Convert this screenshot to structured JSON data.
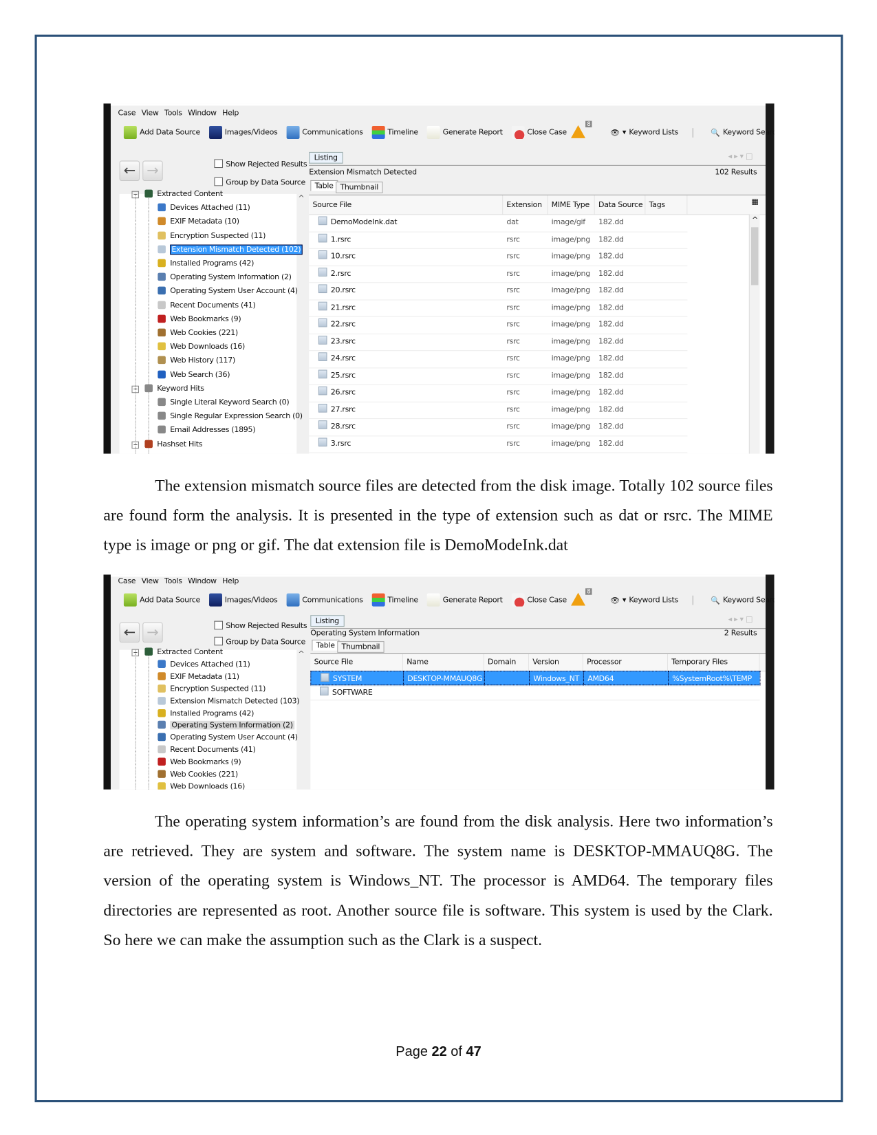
{
  "document": {
    "paragraph_1": "The extension mismatch source files are detected from the disk image. Totally 102 source files are found form the analysis. It is presented in the type of extension such as dat or rsrc. The MIME type is image or png or gif. The dat extension file is DemoModeInk.dat",
    "paragraph_2": "The operating system information’s are found from the disk analysis. Here two information’s are retrieved. They are system and software. The system name is DESKTOP-MMAUQ8G. The version of the operating system is Windows_NT. The processor is AMD64. The temporary files directories are represented as root. Another source file is software. This system is used by the Clark. So here we can make the assumption such as the Clark is a suspect.",
    "footer": {
      "prefix": "Page ",
      "current": "22",
      "middle": " of ",
      "total": "47"
    }
  },
  "app": {
    "menu": [
      "Case",
      "View",
      "Tools",
      "Window",
      "Help"
    ],
    "toolbar": {
      "add_data_source": "Add Data Source",
      "images_videos": "Images/Videos",
      "communications": "Communications",
      "timeline": "Timeline",
      "generate_report": "Generate Report",
      "close_case": "Close Case",
      "warning_count": "8",
      "keyword_lists": "Keyword Lists",
      "keyword_search": "Keyword Search"
    },
    "show_rejected": "Show Rejected Results",
    "group_by_source": "Group by Data Source",
    "listing_tab": "Listing",
    "table_tab": "Table",
    "thumbnail_tab": "Thumbnail",
    "selection_color": "#3399ff"
  },
  "screenshot_1": {
    "title": "Extension Mismatch Detected",
    "results": "102  Results",
    "tree": [
      {
        "label": "Extracted Content",
        "level": 0,
        "icon": "extracted-content-icon"
      },
      {
        "label": "Devices Attached (11)",
        "level": 1,
        "icon": "usb-device-icon"
      },
      {
        "label": "EXIF Metadata (10)",
        "level": 1,
        "icon": "camera-icon"
      },
      {
        "label": "Encryption Suspected (11)",
        "level": 1,
        "icon": "lock-file-icon"
      },
      {
        "label": "Extension Mismatch Detected (102)",
        "level": 1,
        "icon": "file-icon",
        "selected": true
      },
      {
        "label": "Installed Programs (42)",
        "level": 1,
        "icon": "programs-icon"
      },
      {
        "label": "Operating System Information (2)",
        "level": 1,
        "icon": "computer-icon"
      },
      {
        "label": "Operating System User Account (4)",
        "level": 1,
        "icon": "user-icon"
      },
      {
        "label": "Recent Documents (41)",
        "level": 1,
        "icon": "document-icon"
      },
      {
        "label": "Web Bookmarks (9)",
        "level": 1,
        "icon": "bookmark-icon"
      },
      {
        "label": "Web Cookies (221)",
        "level": 1,
        "icon": "cookie-icon"
      },
      {
        "label": "Web Downloads (16)",
        "level": 1,
        "icon": "download-icon"
      },
      {
        "label": "Web History (117)",
        "level": 1,
        "icon": "hourglass-icon"
      },
      {
        "label": "Web Search (36)",
        "level": 1,
        "icon": "globe-icon"
      },
      {
        "label": "Keyword Hits",
        "level": 0,
        "icon": "search-icon"
      },
      {
        "label": "Single Literal Keyword Search (0)",
        "level": 1,
        "icon": "search-icon"
      },
      {
        "label": "Single Regular Expression Search (0)",
        "level": 1,
        "icon": "search-icon"
      },
      {
        "label": "Email Addresses (1895)",
        "level": 1,
        "icon": "search-icon"
      },
      {
        "label": "Hashset Hits",
        "level": 0,
        "icon": "hashset-icon"
      }
    ],
    "columns": [
      "Source File",
      "Extension",
      "MIME Type",
      "Data Source",
      "Tags"
    ],
    "rows": [
      [
        "DemoModeInk.dat",
        "dat",
        "image/gif",
        "182.dd",
        ""
      ],
      [
        "1.rsrc",
        "rsrc",
        "image/png",
        "182.dd",
        ""
      ],
      [
        "10.rsrc",
        "rsrc",
        "image/png",
        "182.dd",
        ""
      ],
      [
        "2.rsrc",
        "rsrc",
        "image/png",
        "182.dd",
        ""
      ],
      [
        "20.rsrc",
        "rsrc",
        "image/png",
        "182.dd",
        ""
      ],
      [
        "21.rsrc",
        "rsrc",
        "image/png",
        "182.dd",
        ""
      ],
      [
        "22.rsrc",
        "rsrc",
        "image/png",
        "182.dd",
        ""
      ],
      [
        "23.rsrc",
        "rsrc",
        "image/png",
        "182.dd",
        ""
      ],
      [
        "24.rsrc",
        "rsrc",
        "image/png",
        "182.dd",
        ""
      ],
      [
        "25.rsrc",
        "rsrc",
        "image/png",
        "182.dd",
        ""
      ],
      [
        "26.rsrc",
        "rsrc",
        "image/png",
        "182.dd",
        ""
      ],
      [
        "27.rsrc",
        "rsrc",
        "image/png",
        "182.dd",
        ""
      ],
      [
        "28.rsrc",
        "rsrc",
        "image/png",
        "182.dd",
        ""
      ],
      [
        "3.rsrc",
        "rsrc",
        "image/png",
        "182.dd",
        ""
      ]
    ]
  },
  "screenshot_2": {
    "title": "Operating System Information",
    "results": "2  Results",
    "tree": [
      {
        "label": "Extracted Content",
        "level": 0,
        "icon": "extracted-content-icon"
      },
      {
        "label": "Devices Attached (11)",
        "level": 1,
        "icon": "usb-device-icon"
      },
      {
        "label": "EXIF Metadata (11)",
        "level": 1,
        "icon": "camera-icon"
      },
      {
        "label": "Encryption Suspected (11)",
        "level": 1,
        "icon": "lock-file-icon"
      },
      {
        "label": "Extension Mismatch Detected (103)",
        "level": 1,
        "icon": "file-icon"
      },
      {
        "label": "Installed Programs (42)",
        "level": 1,
        "icon": "programs-icon"
      },
      {
        "label": "Operating System Information (2)",
        "level": 1,
        "icon": "computer-icon",
        "selected": true
      },
      {
        "label": "Operating System User Account (4)",
        "level": 1,
        "icon": "user-icon"
      },
      {
        "label": "Recent Documents (41)",
        "level": 1,
        "icon": "document-icon"
      },
      {
        "label": "Web Bookmarks (9)",
        "level": 1,
        "icon": "bookmark-icon"
      },
      {
        "label": "Web Cookies (221)",
        "level": 1,
        "icon": "cookie-icon"
      },
      {
        "label": "Web Downloads (16)",
        "level": 1,
        "icon": "download-icon"
      }
    ],
    "columns": [
      "Source File",
      "Name",
      "Domain",
      "Version",
      "Processor Architecture",
      "Temporary Files Directory"
    ],
    "rows": [
      [
        "SYSTEM",
        "DESKTOP-MMAUQ8G",
        "",
        "Windows_NT",
        "AMD64",
        "%SystemRoot%\\TEMP"
      ],
      [
        "SOFTWARE",
        "",
        "",
        "",
        "",
        ""
      ]
    ]
  }
}
